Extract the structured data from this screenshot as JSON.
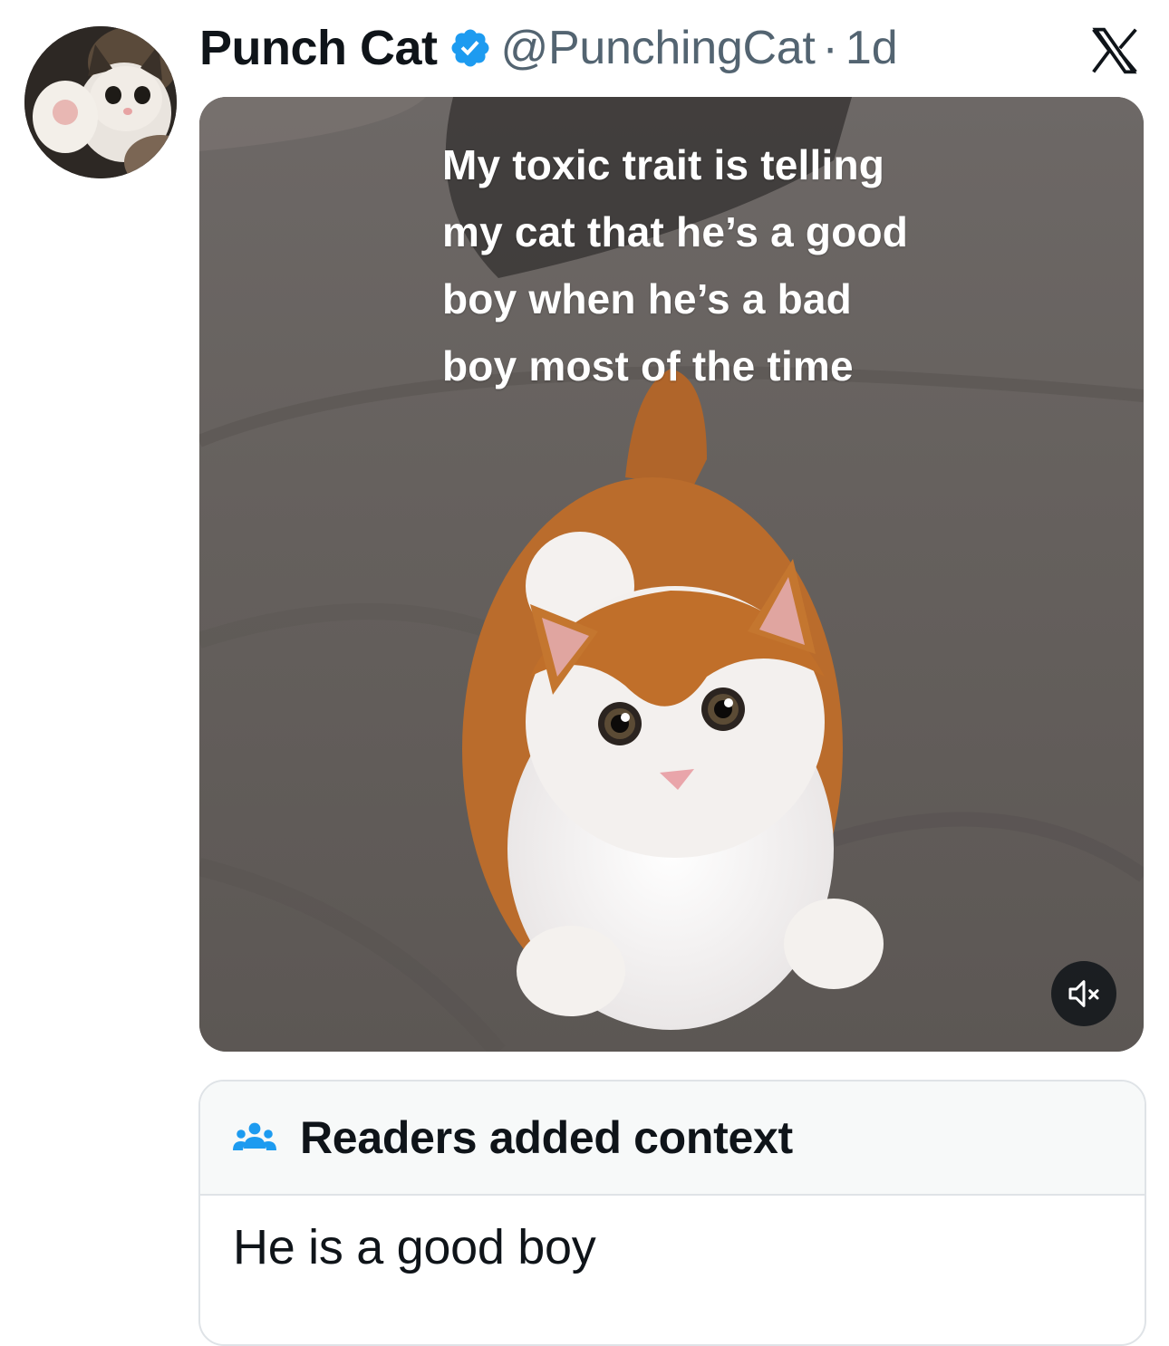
{
  "tweet": {
    "display_name": "Punch Cat",
    "handle": "@PunchingCat",
    "separator": "·",
    "time_ago": "1d",
    "verified": true,
    "platform_icon": "x-logo-icon",
    "avatar_icon": "kitten-avatar",
    "media": {
      "type": "video",
      "caption_lines": [
        "My toxic trait is telling",
        "my cat that he’s a good",
        "boy when he’s a bad",
        "boy most of the time"
      ],
      "mute_icon": "speaker-muted-icon"
    }
  },
  "community_note": {
    "icon": "people-icon",
    "title": "Readers added context",
    "body": "He is a good boy"
  },
  "colors": {
    "verified_blue": "#1d9bf0",
    "secondary_text": "#536471",
    "primary_text": "#0f1419",
    "note_header_bg": "#f7f9f9",
    "border": "#dfe3e7"
  }
}
